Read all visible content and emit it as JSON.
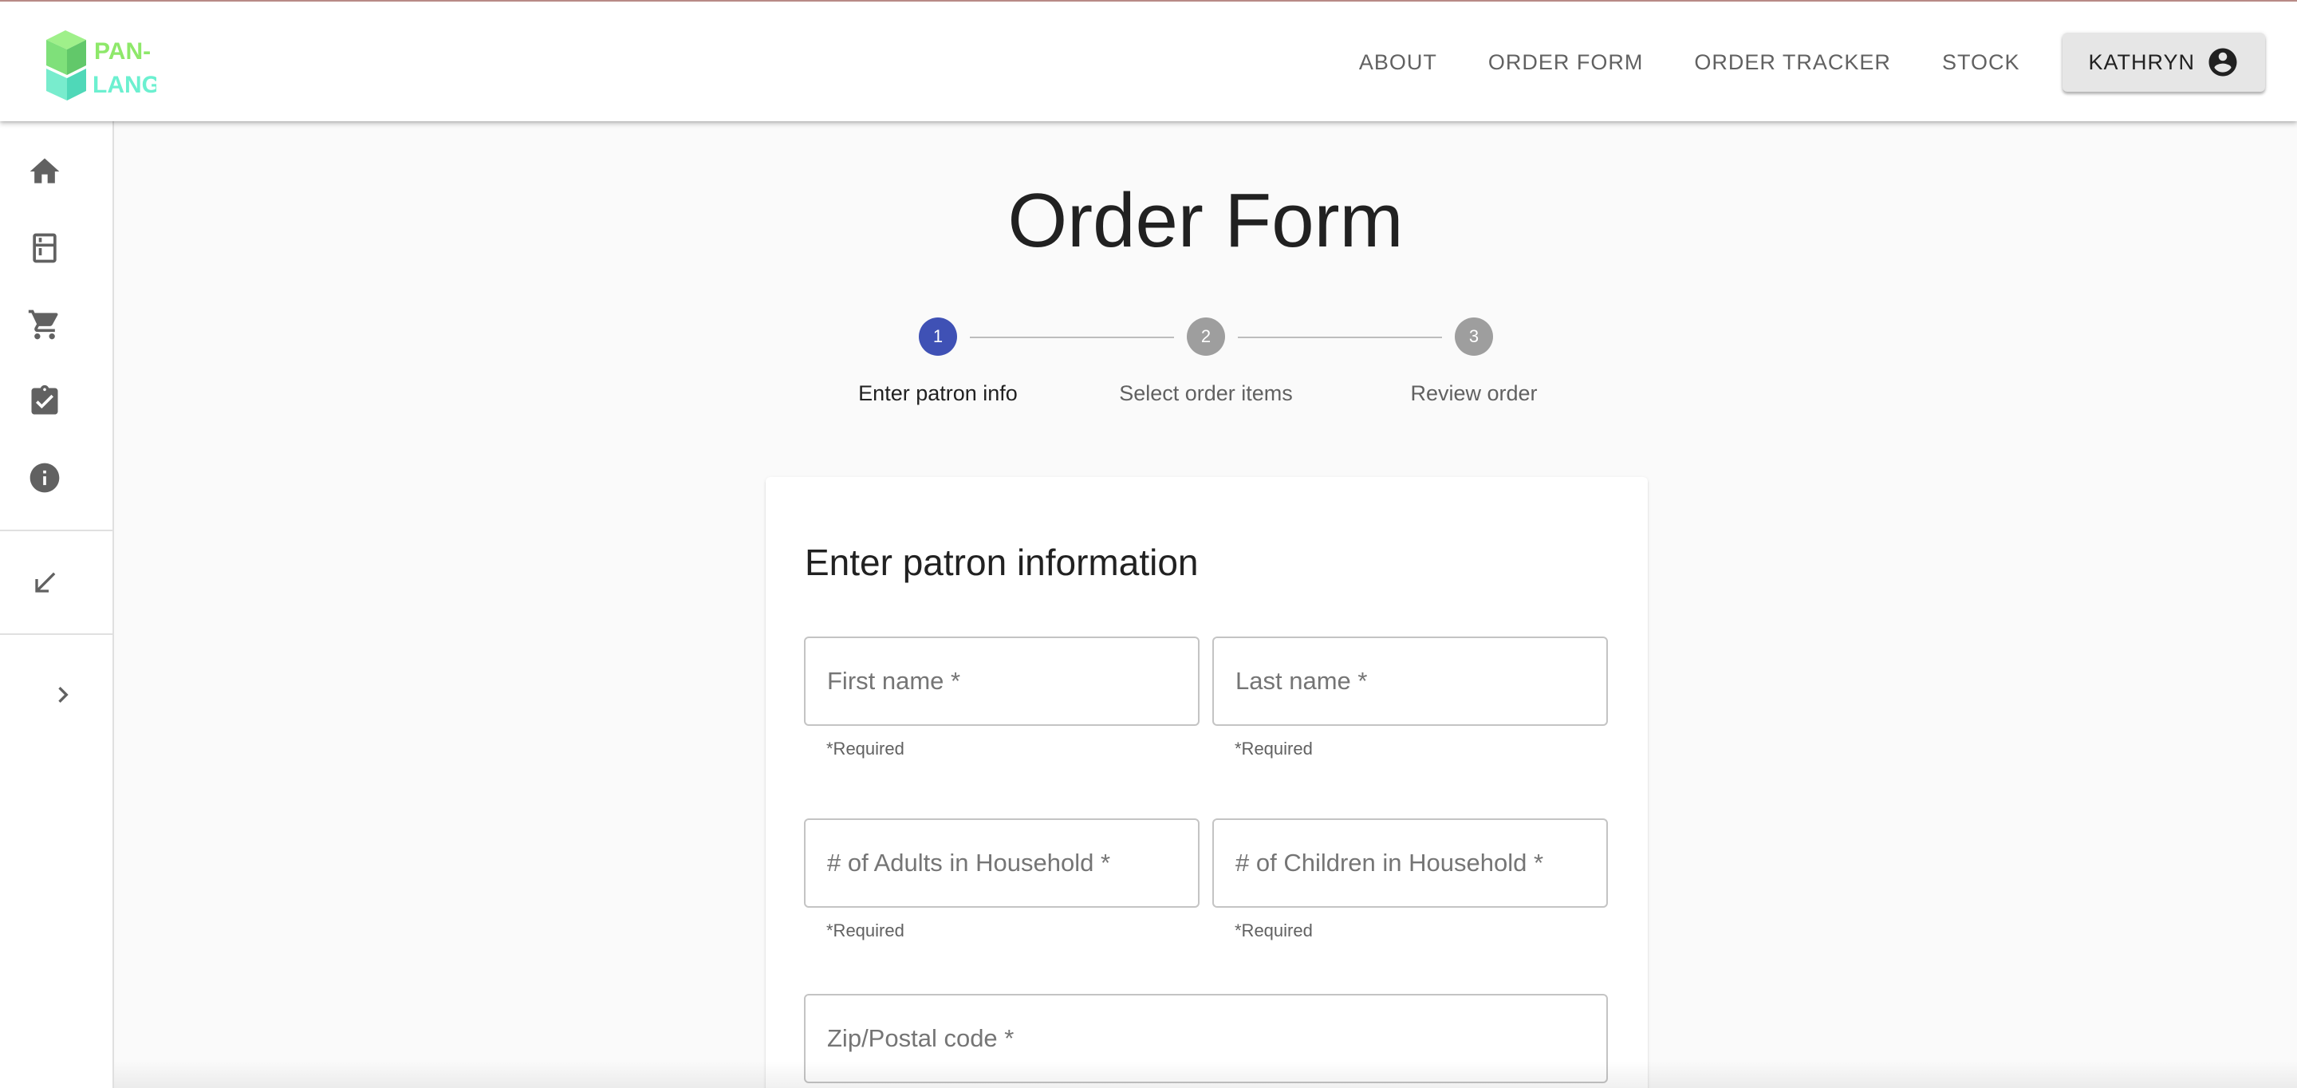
{
  "brand": {
    "logo_text_line1": "PAN-",
    "logo_text_line2": "LANG"
  },
  "nav": {
    "links": [
      "ABOUT",
      "ORDER FORM",
      "ORDER TRACKER",
      "STOCK"
    ],
    "user_label": "KATHRYN"
  },
  "sidebar": {
    "icons": [
      "home-icon",
      "kitchen-icon",
      "shopping-cart-icon",
      "assignment-turned-in-icon",
      "info-icon",
      "arrow-south-west-icon",
      "chevron-right-icon"
    ]
  },
  "page": {
    "title": "Order Form"
  },
  "stepper": {
    "steps": [
      {
        "number": "1",
        "label": "Enter patron info",
        "active": true
      },
      {
        "number": "2",
        "label": "Select order items",
        "active": false
      },
      {
        "number": "3",
        "label": "Review order",
        "active": false
      }
    ]
  },
  "form": {
    "title": "Enter patron information",
    "fields": [
      {
        "placeholder": "First name *",
        "helper": "*Required"
      },
      {
        "placeholder": "Last name *",
        "helper": "*Required"
      },
      {
        "placeholder": "# of Adults in Household *",
        "helper": "*Required"
      },
      {
        "placeholder": "# of Children in Household *",
        "helper": "*Required"
      },
      {
        "placeholder": "Zip/Postal code *",
        "helper": ""
      }
    ]
  },
  "colors": {
    "primary": "#3f51b5",
    "step_inactive": "#9e9e9e",
    "logo_green": "#8ee86a",
    "logo_teal": "#6cf0d0",
    "icon_grey": "#616161"
  }
}
